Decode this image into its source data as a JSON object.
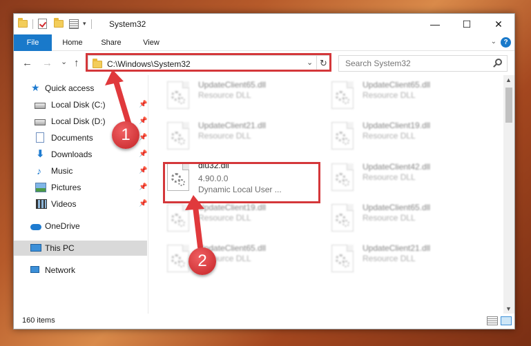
{
  "window": {
    "title": "System32",
    "controls": {
      "minimize": "—",
      "maximize": "☐",
      "close": "✕"
    }
  },
  "ribbon": {
    "tabs": [
      "File",
      "Home",
      "Share",
      "View"
    ],
    "expand_icon": "chevron-down-icon",
    "help": "?"
  },
  "nav": {
    "back": "←",
    "forward": "→",
    "recent": "⌄",
    "up": "↑",
    "address": "C:\\Windows\\System32",
    "search_placeholder": "Search System32"
  },
  "sidebar": {
    "items": [
      {
        "label": "Quick access",
        "icon": "star-icon",
        "pinned": false
      },
      {
        "label": "Local Disk (C:)",
        "icon": "disk-icon",
        "pinned": true
      },
      {
        "label": "Local Disk (D:)",
        "icon": "disk-icon",
        "pinned": true
      },
      {
        "label": "Documents",
        "icon": "documents-icon",
        "pinned": true
      },
      {
        "label": "Downloads",
        "icon": "downloads-icon",
        "pinned": true
      },
      {
        "label": "Music",
        "icon": "music-icon",
        "pinned": true
      },
      {
        "label": "Pictures",
        "icon": "pictures-icon",
        "pinned": true
      },
      {
        "label": "Videos",
        "icon": "videos-icon",
        "pinned": true
      },
      {
        "label": "OneDrive",
        "icon": "onedrive-icon",
        "pinned": false
      },
      {
        "label": "This PC",
        "icon": "this-pc-icon",
        "pinned": false,
        "selected": true
      },
      {
        "label": "Network",
        "icon": "network-icon",
        "pinned": false
      }
    ]
  },
  "files": [
    {
      "name": "UpdateClient65.dll",
      "sub1": "Resource DLL",
      "sub2": "",
      "blurred": true
    },
    {
      "name": "UpdateClient65.dll",
      "sub1": "Resource DLL",
      "sub2": "",
      "blurred": true
    },
    {
      "name": "UpdateClient21.dll",
      "sub1": "Resource DLL",
      "sub2": "",
      "blurred": true
    },
    {
      "name": "UpdateClient19.dll",
      "sub1": "Resource DLL",
      "sub2": "",
      "blurred": true
    },
    {
      "name": "dlu32.dll",
      "sub1": "4.90.0.0",
      "sub2": "Dynamic Local User ...",
      "blurred": false
    },
    {
      "name": "UpdateClient42.dll",
      "sub1": "Resource DLL",
      "sub2": "",
      "blurred": true
    },
    {
      "name": "UpdateClient19.dll",
      "sub1": "Resource DLL",
      "sub2": "",
      "blurred": true
    },
    {
      "name": "UpdateClient65.dll",
      "sub1": "Resource DLL",
      "sub2": "",
      "blurred": true
    },
    {
      "name": "UpdateClient65.dll",
      "sub1": "Resource DLL",
      "sub2": "",
      "blurred": true
    },
    {
      "name": "UpdateClient21.dll",
      "sub1": "Resource DLL",
      "sub2": "",
      "blurred": true
    }
  ],
  "status": {
    "item_count": "160 items"
  },
  "annotations": {
    "step1": "1",
    "step2": "2",
    "color": "#d4373a"
  }
}
